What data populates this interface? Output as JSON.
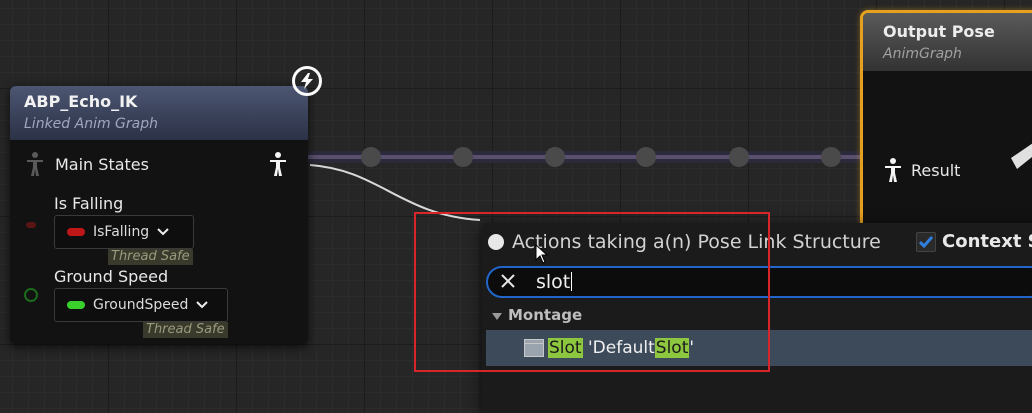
{
  "colors": {
    "pose_wire": "#c8c8d2",
    "accent_orange": "#e6a020",
    "highlight_red": "#d8242b",
    "search_focus": "#2266cc",
    "match_green": "#8dc63f"
  },
  "linked_node": {
    "title": "ABP_Echo_IK",
    "subtitle": "Linked Anim Graph",
    "pins": {
      "main_states": "Main States",
      "is_falling": {
        "label": "Is Falling",
        "value": "IsFalling",
        "badge": "Thread Safe"
      },
      "ground_speed": {
        "label": "Ground Speed",
        "value": "GroundSpeed",
        "badge": "Thread Safe"
      }
    },
    "icons": [
      "person-icon",
      "lightning-icon",
      "chevron-down-icon"
    ]
  },
  "output_node": {
    "title": "Output Pose",
    "subtitle": "AnimGraph",
    "pin": "Result"
  },
  "action_menu": {
    "title": "Actions taking a(n) Pose Link Structure",
    "context_label": "Context Se",
    "context_checked": true,
    "search": {
      "value": "slot"
    },
    "category": "Montage",
    "item": {
      "part1": "Slot",
      "part2": " 'Default",
      "part3": "Slot",
      "part4": "'"
    }
  }
}
